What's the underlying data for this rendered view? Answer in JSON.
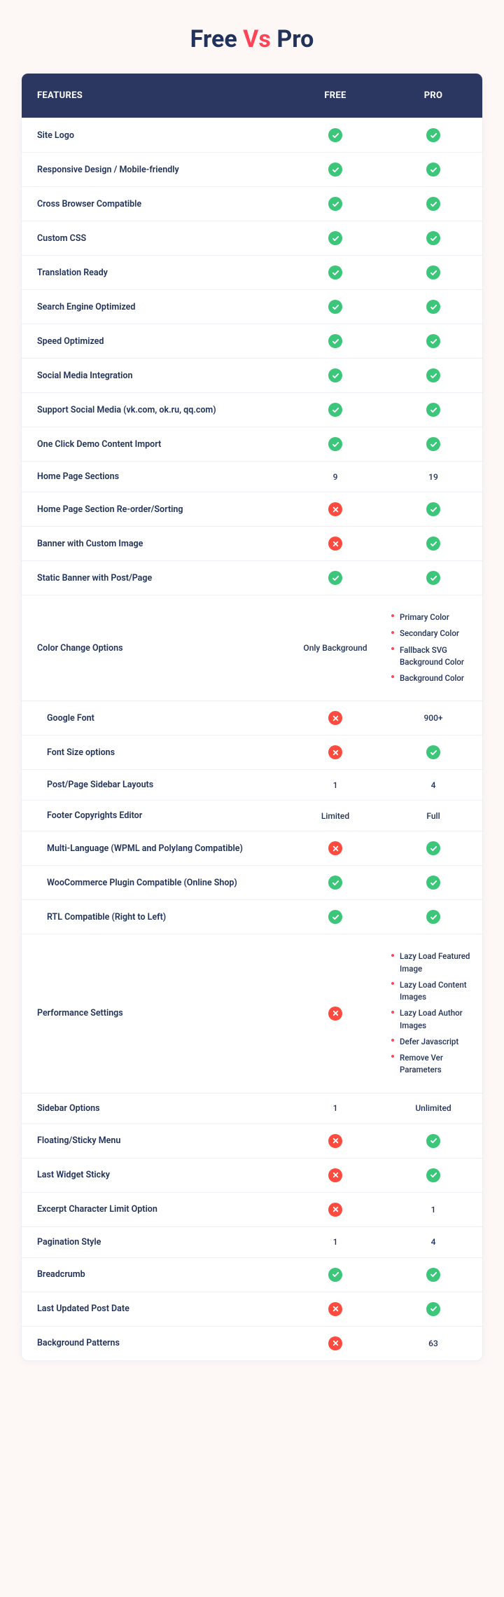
{
  "title_parts": {
    "a": "Free",
    "vs": "Vs",
    "b": "Pro"
  },
  "header": {
    "features": "FEATURES",
    "free": "FREE",
    "pro": "PRO"
  },
  "rows": [
    {
      "label": "Site Logo",
      "free": {
        "t": "check"
      },
      "pro": {
        "t": "check"
      }
    },
    {
      "label": "Responsive Design / Mobile-friendly",
      "free": {
        "t": "check"
      },
      "pro": {
        "t": "check"
      }
    },
    {
      "label": "Cross Browser Compatible",
      "free": {
        "t": "check"
      },
      "pro": {
        "t": "check"
      }
    },
    {
      "label": "Custom CSS",
      "free": {
        "t": "check"
      },
      "pro": {
        "t": "check"
      }
    },
    {
      "label": "Translation Ready",
      "free": {
        "t": "check"
      },
      "pro": {
        "t": "check"
      }
    },
    {
      "label": "Search Engine Optimized",
      "free": {
        "t": "check"
      },
      "pro": {
        "t": "check"
      }
    },
    {
      "label": "Speed Optimized",
      "free": {
        "t": "check"
      },
      "pro": {
        "t": "check"
      }
    },
    {
      "label": "Social Media Integration",
      "free": {
        "t": "check"
      },
      "pro": {
        "t": "check"
      }
    },
    {
      "label": "Support Social Media (vk.com, ok.ru, qq.com)",
      "free": {
        "t": "check"
      },
      "pro": {
        "t": "check"
      }
    },
    {
      "label": "One Click Demo Content Import",
      "free": {
        "t": "check"
      },
      "pro": {
        "t": "check"
      }
    },
    {
      "label": "Home Page Sections",
      "free": {
        "t": "text",
        "v": "9"
      },
      "pro": {
        "t": "text",
        "v": "19"
      }
    },
    {
      "label": "Home Page Section Re-order/Sorting",
      "free": {
        "t": "cross"
      },
      "pro": {
        "t": "check"
      }
    },
    {
      "label": "Banner with Custom Image",
      "free": {
        "t": "cross"
      },
      "pro": {
        "t": "check"
      }
    },
    {
      "label": "Static Banner with Post/Page",
      "free": {
        "t": "check"
      },
      "pro": {
        "t": "check"
      }
    },
    {
      "label": "Color Change Options",
      "tall": true,
      "free": {
        "t": "text",
        "v": "Only Background"
      },
      "pro": {
        "t": "list",
        "v": [
          "Primary Color",
          "Secondary Color",
          "Fallback SVG Background Color",
          "Background Color"
        ]
      }
    },
    {
      "label": "Google Font",
      "indent": true,
      "free": {
        "t": "cross"
      },
      "pro": {
        "t": "text",
        "v": "900+"
      }
    },
    {
      "label": "Font Size options",
      "indent": true,
      "free": {
        "t": "cross"
      },
      "pro": {
        "t": "check"
      }
    },
    {
      "label": "Post/Page Sidebar Layouts",
      "indent": true,
      "free": {
        "t": "text",
        "v": "1"
      },
      "pro": {
        "t": "text",
        "v": "4"
      }
    },
    {
      "label": "Footer Copyrights Editor",
      "indent": true,
      "free": {
        "t": "text",
        "v": "Limited"
      },
      "pro": {
        "t": "text",
        "v": "Full"
      }
    },
    {
      "label": "Multi-Language (WPML and Polylang Compatible)",
      "indent": true,
      "free": {
        "t": "cross"
      },
      "pro": {
        "t": "check"
      }
    },
    {
      "label": "WooCommerce Plugin Compatible (Online Shop)",
      "indent": true,
      "free": {
        "t": "check"
      },
      "pro": {
        "t": "check"
      }
    },
    {
      "label": "RTL Compatible (Right to Left)",
      "indent": true,
      "free": {
        "t": "check"
      },
      "pro": {
        "t": "check"
      }
    },
    {
      "label": "Performance Settings",
      "tall": true,
      "free": {
        "t": "cross"
      },
      "pro": {
        "t": "list",
        "v": [
          "Lazy Load Featured Image",
          "Lazy Load Content Images",
          "Lazy Load Author Images",
          "Defer Javascript",
          "Remove Ver Parameters"
        ]
      }
    },
    {
      "label": "Sidebar Options",
      "free": {
        "t": "text",
        "v": "1"
      },
      "pro": {
        "t": "text",
        "v": "Unlimited"
      }
    },
    {
      "label": "Floating/Sticky Menu",
      "free": {
        "t": "cross"
      },
      "pro": {
        "t": "check"
      }
    },
    {
      "label": "Last Widget Sticky",
      "free": {
        "t": "cross"
      },
      "pro": {
        "t": "check"
      }
    },
    {
      "label": "Excerpt Character Limit Option",
      "free": {
        "t": "cross"
      },
      "pro": {
        "t": "text",
        "v": "1"
      }
    },
    {
      "label": "Pagination Style",
      "free": {
        "t": "text",
        "v": "1"
      },
      "pro": {
        "t": "text",
        "v": "4"
      }
    },
    {
      "label": "Breadcrumb",
      "free": {
        "t": "check"
      },
      "pro": {
        "t": "check"
      }
    },
    {
      "label": "Last Updated Post Date",
      "free": {
        "t": "cross"
      },
      "pro": {
        "t": "check"
      }
    },
    {
      "label": "Background Patterns",
      "free": {
        "t": "cross"
      },
      "pro": {
        "t": "text",
        "v": "63"
      }
    }
  ]
}
